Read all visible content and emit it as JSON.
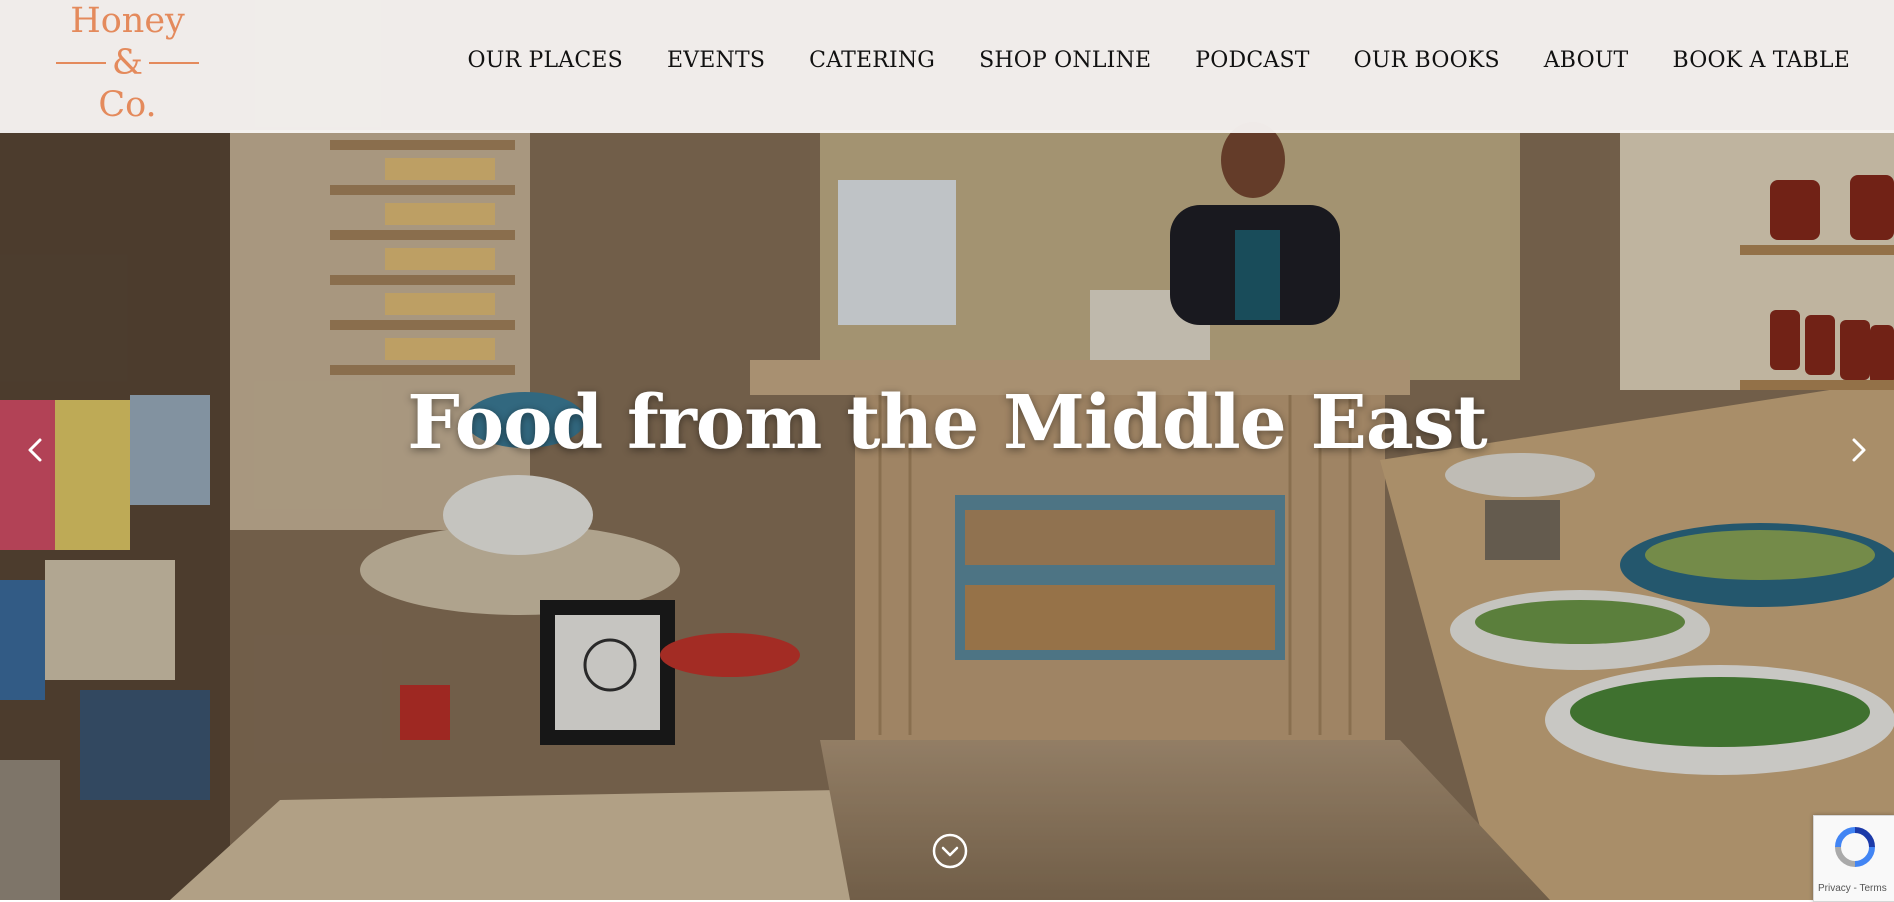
{
  "brand": {
    "line1": "Honey",
    "line2": "&",
    "line3": "Co.",
    "color": "#e48a5c"
  },
  "nav": {
    "items": [
      {
        "label": "OUR PLACES"
      },
      {
        "label": "EVENTS"
      },
      {
        "label": "CATERING"
      },
      {
        "label": "SHOP ONLINE"
      },
      {
        "label": "PODCAST"
      },
      {
        "label": "OUR BOOKS"
      },
      {
        "label": "ABOUT"
      },
      {
        "label": "BOOK A TABLE"
      }
    ]
  },
  "hero": {
    "headline": "Food from the Middle East",
    "prev_icon": "chevron-left-icon",
    "next_icon": "chevron-right-icon",
    "scroll_icon": "chevron-down-circle-icon"
  },
  "recaptcha": {
    "text": "Privacy - Terms"
  }
}
